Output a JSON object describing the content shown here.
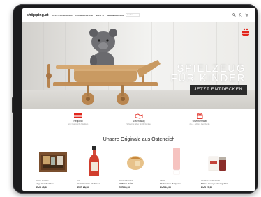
{
  "header": {
    "logo": "shöpping.at",
    "nav_items": [
      "ALLE KATEGORIEN",
      "TRAGBERGLOSE",
      "SALE %",
      "INFO & DIENSTE"
    ],
    "search_placeholder": "Suchen"
  },
  "hero": {
    "title_line1": "SPIELZEUG",
    "title_line2": "FÜR KINDER",
    "cta": "JETZT ENTDECKEN",
    "badge_color": "#e1261c"
  },
  "features": [
    {
      "title": "Regional",
      "subtitle": "Von Österreichs Händlern",
      "icon": "austria-flag-icon"
    },
    {
      "title": "Zuverlässig",
      "subtitle": "Schnell & sicher ab 20€ Einkauf",
      "icon": "handshake-icon"
    },
    {
      "title": "Unverkennbar",
      "subtitle": "20+ ... schöne Geschenke",
      "icon": "gift-icon"
    }
  ],
  "section": {
    "title": "Unsere Originale aus Österreich"
  },
  "products": [
    {
      "brand": "Bauer & Bauer",
      "name": "Jagd Geschenkbox",
      "price": "EUR 45,00",
      "icon": "gift-box-icon"
    },
    {
      "brand": "Kiz",
      "name": "Heartland Gin · Schiavere",
      "price": "EUR 28,50",
      "icon": "bottle-icon"
    },
    {
      "brand": "GRÄFIN ECKEN",
      "name": "ZIRBEN LIKÖR",
      "price": "EUR 39,90",
      "icon": "soap-icon"
    },
    {
      "brand": "Babila",
      "name": "Thailer Rose Bodylotion",
      "price": "EUR 11,99",
      "icon": "lotion-tube-icon"
    },
    {
      "brand": "Fernand's Pharmazeie",
      "name": "Billets · Honey's Naschgeföhl",
      "price": "EUR 27,90",
      "icon": "jar-icon"
    }
  ]
}
